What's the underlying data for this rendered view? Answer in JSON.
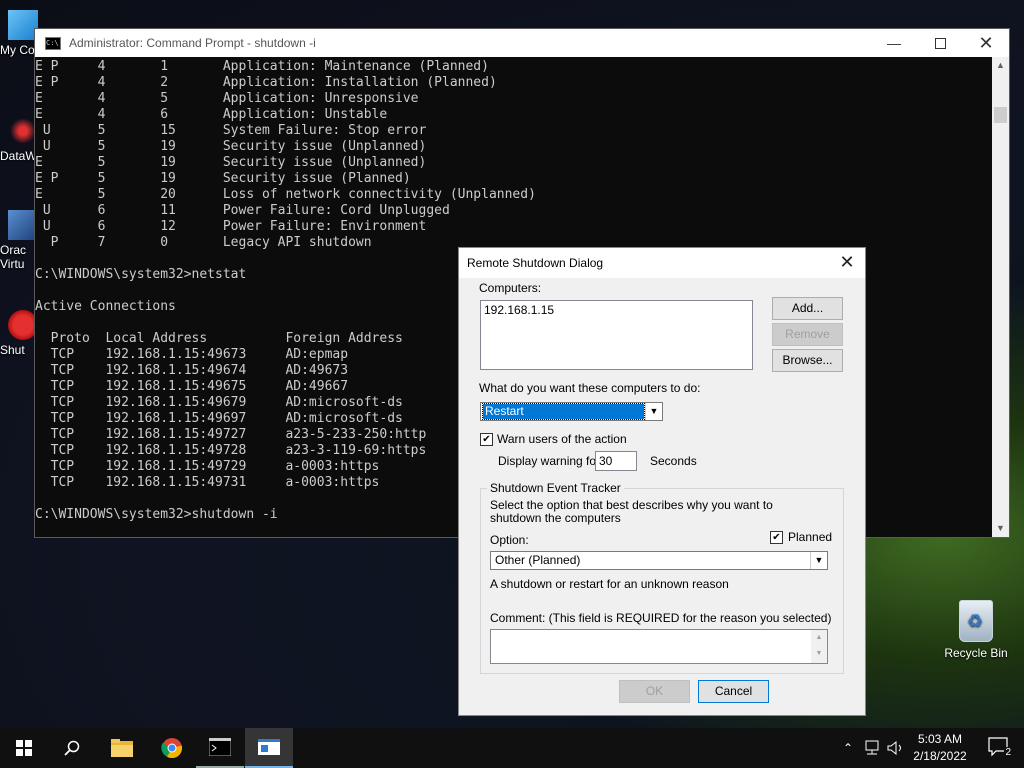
{
  "desktop": {
    "icons_left": [
      {
        "label": "My Co",
        "icon": "this-pc-icon"
      },
      {
        "label": "DataW",
        "icon": "datawarrior-icon"
      },
      {
        "label": "Orac\nVirtu",
        "icon": "virtualbox-icon"
      },
      {
        "label": "Shut",
        "icon": "shutdown-icon"
      }
    ],
    "recycle_bin": {
      "label": "Recycle Bin",
      "icon": "recycle-bin-icon"
    }
  },
  "cmd": {
    "title": "Administrator: Command Prompt - shutdown  -i",
    "lines": [
      "E P     4       1       Application: Maintenance (Planned)",
      "E P     4       2       Application: Installation (Planned)",
      "E       4       5       Application: Unresponsive",
      "E       4       6       Application: Unstable",
      " U      5       15      System Failure: Stop error",
      " U      5       19      Security issue (Unplanned)",
      "E       5       19      Security issue (Unplanned)",
      "E P     5       19      Security issue (Planned)",
      "E       5       20      Loss of network connectivity (Unplanned)",
      " U      6       11      Power Failure: Cord Unplugged",
      " U      6       12      Power Failure: Environment",
      "  P     7       0       Legacy API shutdown",
      "",
      "C:\\WINDOWS\\system32>netstat",
      "",
      "Active Connections",
      "",
      "  Proto  Local Address          Foreign Address",
      "  TCP    192.168.1.15:49673     AD:epmap",
      "  TCP    192.168.1.15:49674     AD:49673",
      "  TCP    192.168.1.15:49675     AD:49667",
      "  TCP    192.168.1.15:49679     AD:microsoft-ds",
      "  TCP    192.168.1.15:49697     AD:microsoft-ds",
      "  TCP    192.168.1.15:49727     a23-5-233-250:http",
      "  TCP    192.168.1.15:49728     a23-3-119-69:https",
      "  TCP    192.168.1.15:49729     a-0003:https",
      "  TCP    192.168.1.15:49731     a-0003:https",
      "",
      "C:\\WINDOWS\\system32>shutdown -i"
    ]
  },
  "dialog": {
    "title": "Remote Shutdown Dialog",
    "computers_label": "Computers:",
    "computers": [
      "192.168.1.15"
    ],
    "add_label": "Add...",
    "remove_label": "Remove",
    "browse_label": "Browse...",
    "action_label": "What do you want these computers to do:",
    "action_value": "Restart",
    "warn_label": "Warn users of the action",
    "warn_checked": true,
    "display_warning_label": "Display warning for",
    "display_warning_value": "30",
    "seconds_label": "Seconds",
    "tracker_label": "Shutdown Event Tracker",
    "tracker_desc": "Select the option that best describes why you want to shutdown the computers",
    "option_label": "Option:",
    "planned_label": "Planned",
    "planned_checked": true,
    "option_value": "Other (Planned)",
    "option_desc": "A shutdown or restart for an unknown reason",
    "comment_label": "Comment: (This field is REQUIRED for the reason you selected)",
    "comment_value": "",
    "ok_label": "OK",
    "cancel_label": "Cancel"
  },
  "taskbar": {
    "clock_time": "5:03 AM",
    "clock_date": "2/18/2022",
    "notification_count": "2"
  }
}
